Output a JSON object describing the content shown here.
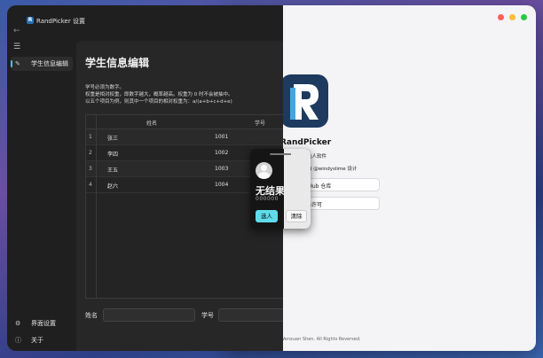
{
  "settings_window": {
    "title": "RandPicker 设置",
    "app_icon_letter": "R",
    "sidebar": {
      "items": [
        {
          "label": "学生信息编辑",
          "icon": "pencil-icon"
        },
        {
          "label": "界面设置",
          "icon": "gear-icon"
        },
        {
          "label": "关于",
          "icon": "info-icon"
        }
      ]
    },
    "page": {
      "title": "学生信息编辑",
      "hints": [
        "学号必须为数字。",
        "权重是相对权重，即数字越大，概率越高。权重为 0 时不会被抽中。",
        "以五个项目为例，则其中一个项目的相对权重为：a/(a+b+c+d+e)"
      ],
      "table": {
        "columns": [
          "姓名",
          "学号"
        ],
        "rows": [
          {
            "index": "1",
            "name": "张三",
            "id": "1001"
          },
          {
            "index": "2",
            "name": "李四",
            "id": "1002"
          },
          {
            "index": "3",
            "name": "王五",
            "id": "1003"
          },
          {
            "index": "4",
            "name": "赵六",
            "id": "1004"
          }
        ]
      },
      "form": {
        "name_label": "姓名",
        "id_label": "学号"
      }
    }
  },
  "picker": {
    "result": "无结果",
    "id": "000000",
    "pick_label": "选人",
    "clear_label": "清除"
  },
  "about_window": {
    "app_name": "RandPicker",
    "description": "选人软件",
    "author": "由 @windyslime 设计",
    "buttons": [
      "tHub 仓库",
      "码许可"
    ],
    "copyright": "Wenxuan Shen, All Rights Reversed."
  },
  "colors": {
    "accent": "#5fdcec",
    "sidebar_indicator": "#5bb8e8",
    "logo_bg": "#1e3a5f"
  }
}
